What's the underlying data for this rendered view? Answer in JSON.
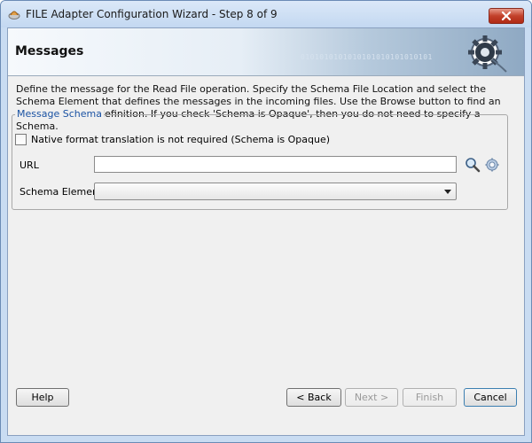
{
  "window": {
    "title": "FILE Adapter Configuration Wizard - Step 8 of 9"
  },
  "banner": {
    "title": "Messages",
    "binary_text": "0101010101010101010101010101"
  },
  "description": "Define the message for the Read File operation.  Specify the Schema File Location and select the Schema Element that defines the messages in the incoming files. Use the Browse button to find an existing schema definition. If you check 'Schema is Opaque', then you do not need to specify a Schema.",
  "schema": {
    "legend": "Message Schema",
    "opaque_checkbox": {
      "label": "Native format translation is not required (Schema is Opaque)",
      "checked": false
    },
    "url": {
      "label": "URL",
      "value": ""
    },
    "schema_element": {
      "label": "Schema Element",
      "value": ""
    }
  },
  "buttons": {
    "help": "Help",
    "back": "< Back",
    "next": "Next >",
    "finish": "Finish",
    "cancel": "Cancel"
  },
  "icons": [
    "window-app-icon",
    "close-icon",
    "gear-banner-icon",
    "search-icon",
    "configure-icon",
    "chevron-down-icon"
  ]
}
